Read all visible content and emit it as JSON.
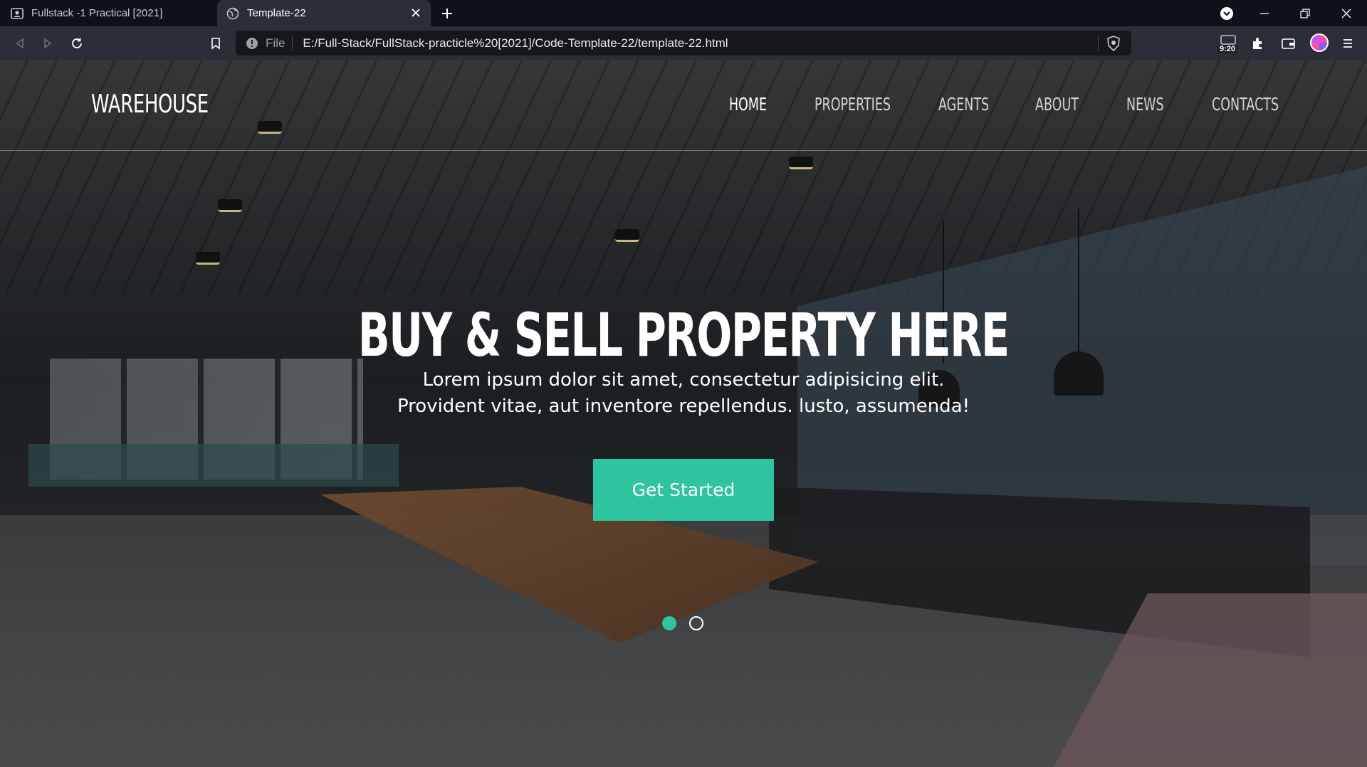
{
  "browser": {
    "tabs": [
      {
        "title": "Fullstack -1 Practical [2021]",
        "active": false
      },
      {
        "title": "Template-22",
        "active": true
      }
    ],
    "address": {
      "scheme_label": "File",
      "url": "E:/Full-Stack/FullStack-practicle%20[2021]/Code-Template-22/template-22.html"
    },
    "extension_badge": "9:20"
  },
  "site": {
    "logo": "WAREHOUSE",
    "nav": [
      {
        "label": "HOME",
        "active": true
      },
      {
        "label": "PROPERTIES",
        "active": false
      },
      {
        "label": "AGENTS",
        "active": false
      },
      {
        "label": "ABOUT",
        "active": false
      },
      {
        "label": "NEWS",
        "active": false
      },
      {
        "label": "CONTACTS",
        "active": false
      }
    ]
  },
  "hero": {
    "title": "BUY & SELL PROPERTY HERE",
    "text_line1": "Lorem ipsum dolor sit amet, consectetur adipisicing elit.",
    "text_line2": "Provident vitae, aut inventore repellendus. lusto, assumenda!",
    "cta_label": "Get Started",
    "slides": {
      "count": 2,
      "active_index": 0
    }
  },
  "colors": {
    "accent": "#2ec4a0",
    "tabbar": "#0f111a",
    "toolbar": "#2b2e36"
  }
}
